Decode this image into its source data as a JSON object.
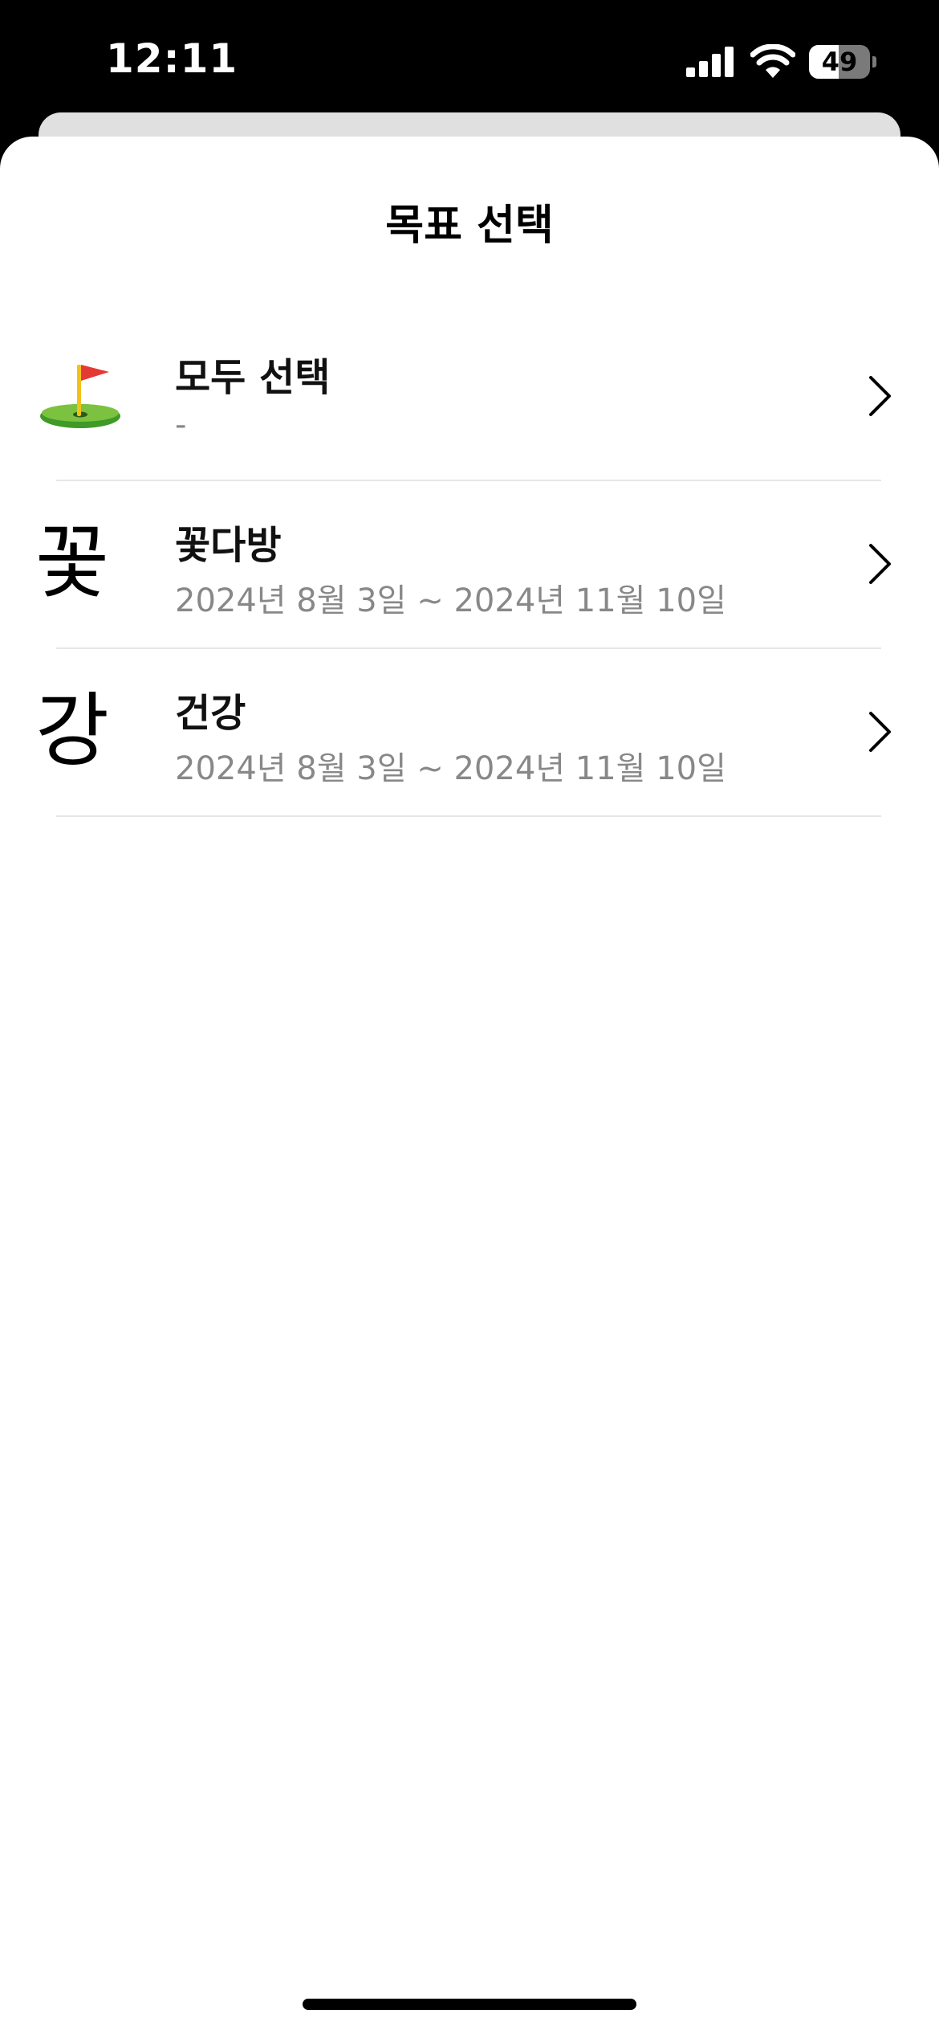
{
  "status_bar": {
    "time": "12:11",
    "battery_level": "49",
    "battery_fraction": 0.49,
    "icons": [
      "signal-icon",
      "wifi-icon",
      "battery-icon"
    ]
  },
  "sheet": {
    "title": "목표 선택"
  },
  "goals": [
    {
      "icon": "golf-flag-icon",
      "char": "",
      "name": "모두 선택",
      "period": "-"
    },
    {
      "icon": "",
      "char": "꽃",
      "name": "꽃다방",
      "period": "2024년 8월 3일 ~ 2024년 11월 10일"
    },
    {
      "icon": "",
      "char": "강",
      "name": "건강",
      "period": "2024년 8월 3일 ~ 2024년 11월 10일"
    }
  ],
  "colors": {
    "background": "#000000",
    "sheet": "#ffffff",
    "secondary_text": "#888888",
    "divider": "#e6e6e6"
  }
}
